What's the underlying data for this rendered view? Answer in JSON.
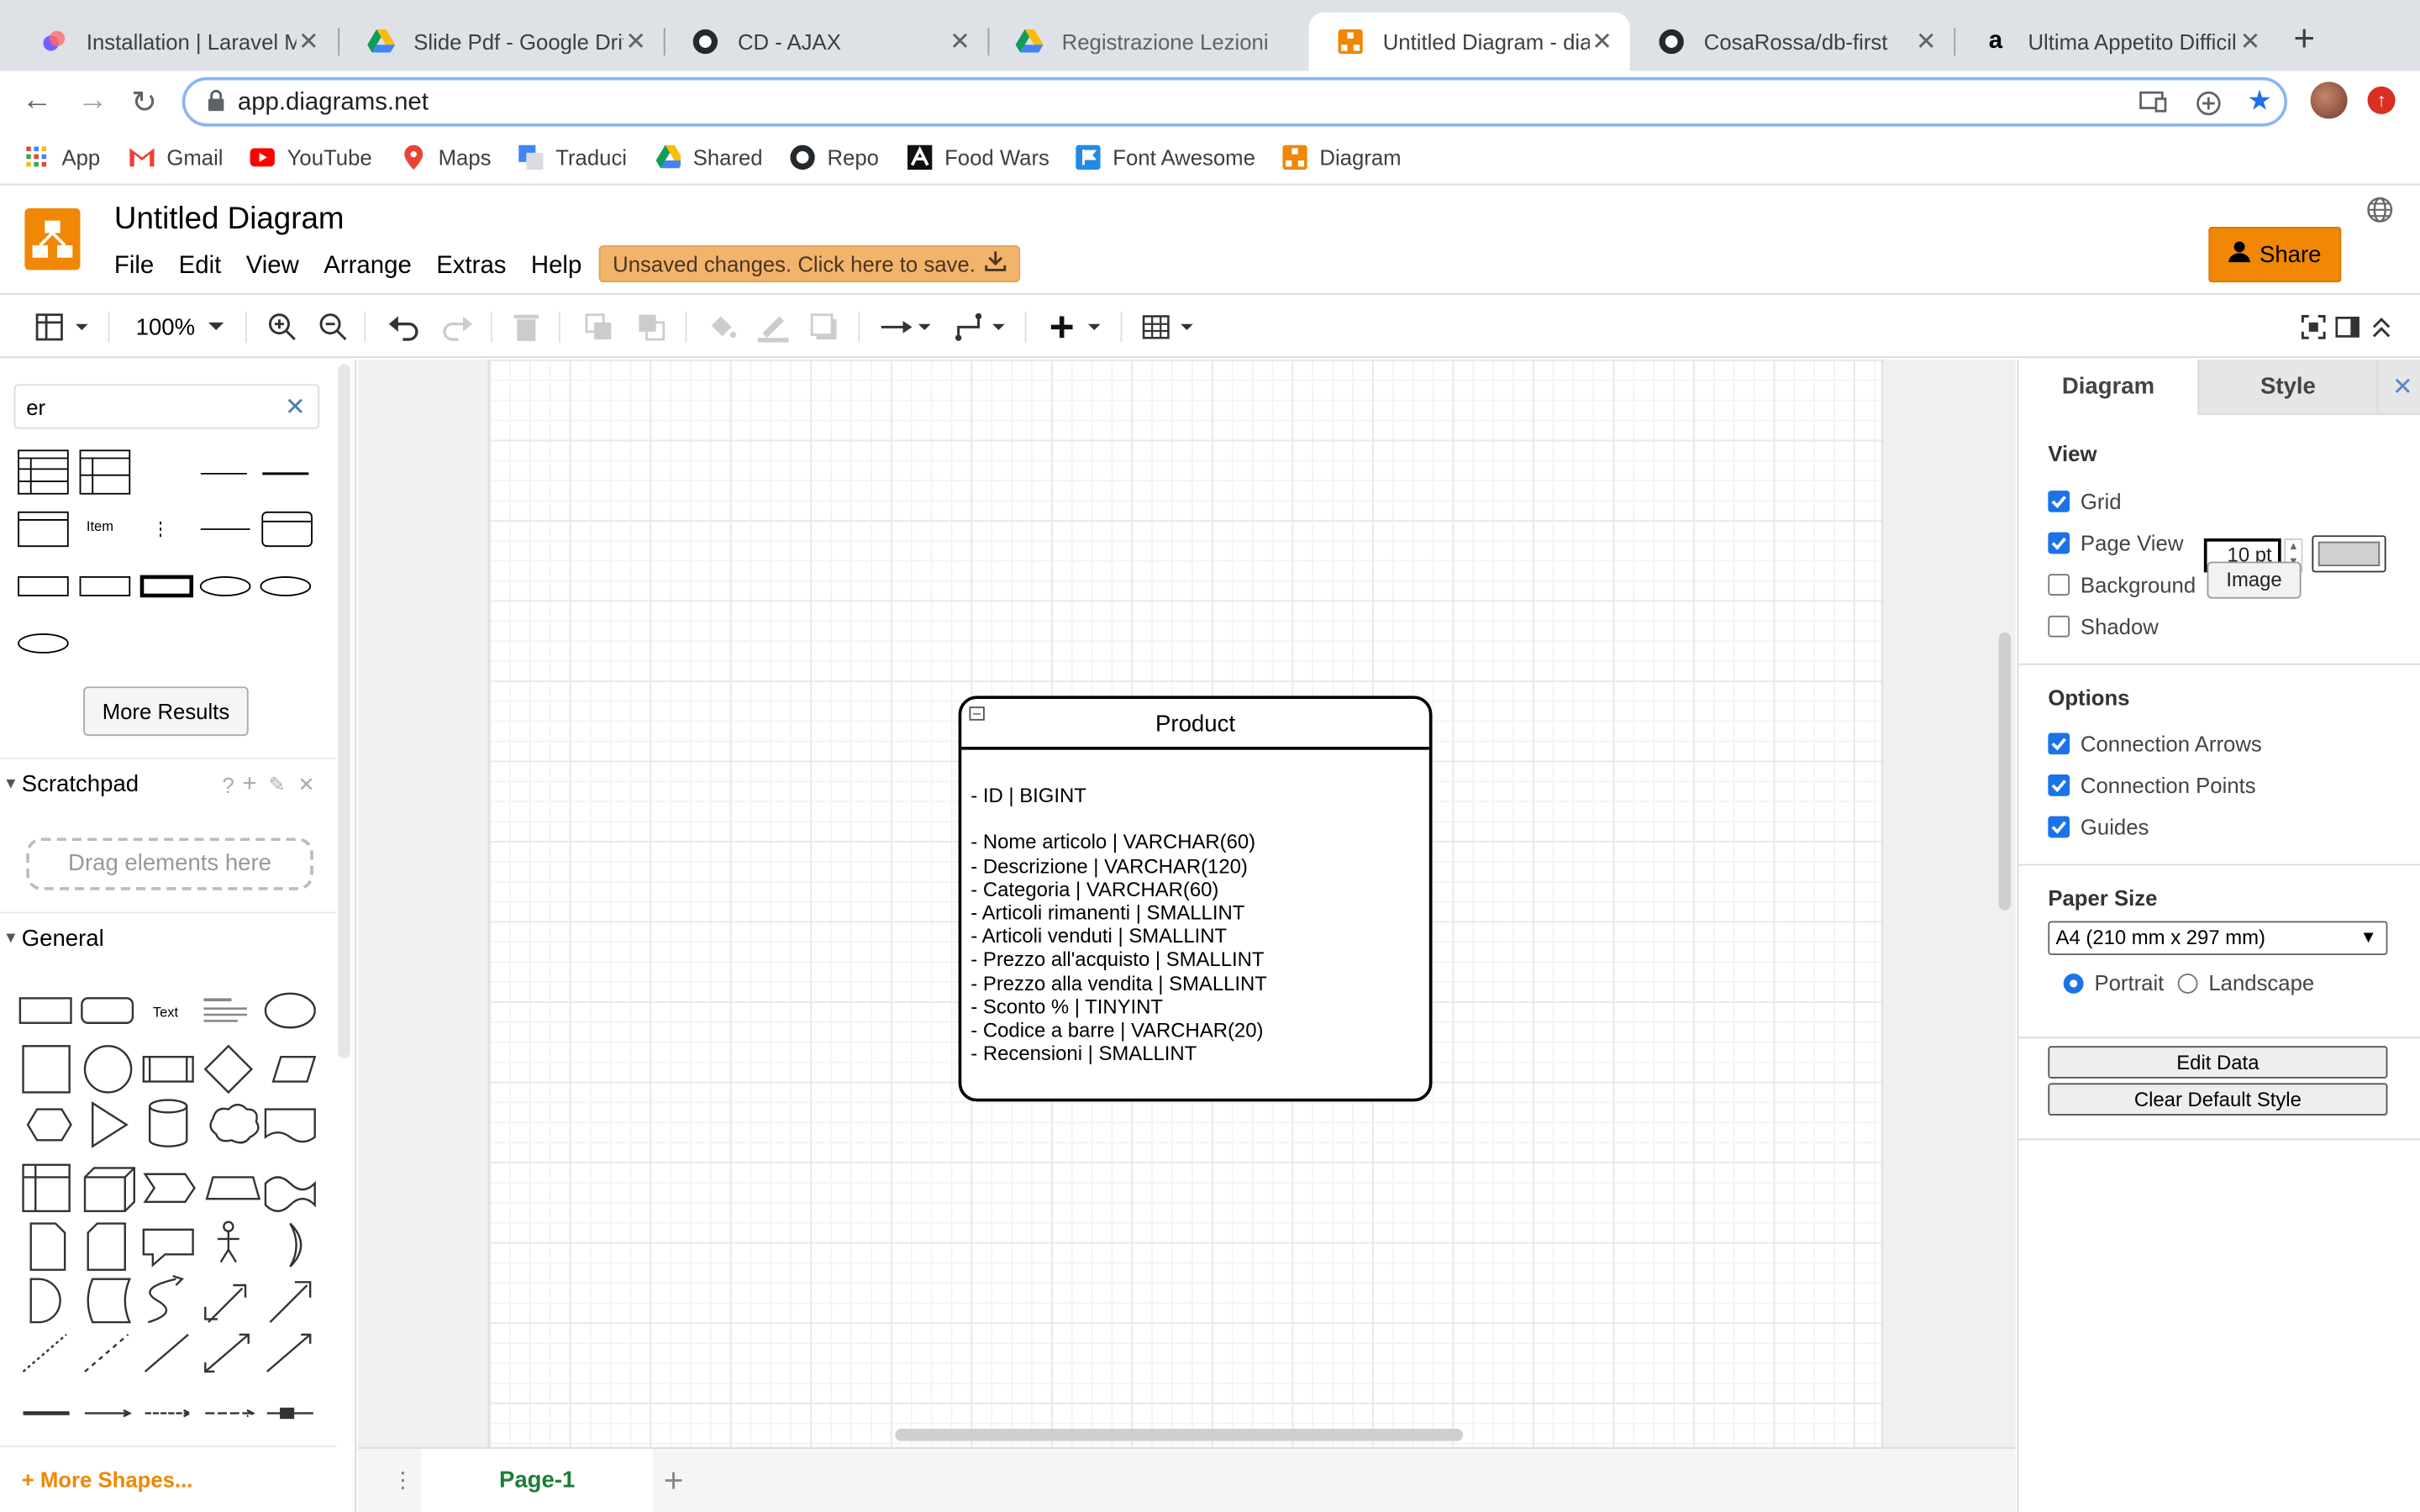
{
  "browser": {
    "tabs": [
      {
        "title": "Installation | Laravel M",
        "icon": "laravel-icon"
      },
      {
        "title": "Slide Pdf - Google Driv",
        "icon": "google-drive-icon"
      },
      {
        "title": "CD - AJAX",
        "icon": "github-icon"
      },
      {
        "title": "Registrazione Lezioni",
        "icon": "google-drive-icon"
      },
      {
        "title": "Untitled Diagram - dia",
        "icon": "drawio-icon"
      },
      {
        "title": "CosaRossa/db-first",
        "icon": "github-icon"
      },
      {
        "title": "Ultima Appetito Difficil",
        "icon": "amazon-icon"
      }
    ],
    "url": "app.diagrams.net",
    "bookmarks": [
      {
        "label": "App",
        "icon": "apps-grid-icon"
      },
      {
        "label": "Gmail",
        "icon": "gmail-icon"
      },
      {
        "label": "YouTube",
        "icon": "youtube-icon"
      },
      {
        "label": "Maps",
        "icon": "maps-icon"
      },
      {
        "label": "Traduci",
        "icon": "translate-icon"
      },
      {
        "label": "Shared",
        "icon": "google-drive-icon"
      },
      {
        "label": "Repo",
        "icon": "github-icon"
      },
      {
        "label": "Food Wars",
        "icon": "anime-icon"
      },
      {
        "label": "Font Awesome",
        "icon": "flag-icon"
      },
      {
        "label": "Diagram",
        "icon": "drawio-icon"
      }
    ]
  },
  "app": {
    "title": "Untitled Diagram",
    "menu": [
      "File",
      "Edit",
      "View",
      "Arrange",
      "Extras",
      "Help"
    ],
    "unsaved": "Unsaved changes. Click here to save.",
    "share": "Share",
    "zoom": "100%",
    "accent": "#f08705"
  },
  "left": {
    "search_value": "er",
    "item_label": "Item",
    "more_results": "More Results",
    "scratchpad": "Scratchpad",
    "drag_hint": "Drag elements here",
    "general": "General",
    "text_shape": "Text",
    "more_shapes": "+ More Shapes..."
  },
  "diagram": {
    "entity_title": "Product",
    "entity_body": "- ID | BIGINT\n\n- Nome articolo | VARCHAR(60)\n- Descrizione | VARCHAR(120)\n- Categoria | VARCHAR(60)\n- Articoli rimanenti | SMALLINT\n- Articoli venduti | SMALLINT\n- Prezzo all'acquisto | SMALLINT\n- Prezzo alla vendita | SMALLINT\n- Sconto % | TINYINT\n- Codice a barre | VARCHAR(20)\n- Recensioni | SMALLINT"
  },
  "pages": {
    "current": "Page-1"
  },
  "right": {
    "tab_diagram": "Diagram",
    "tab_style": "Style",
    "view_title": "View",
    "grid": {
      "label": "Grid",
      "checked": true,
      "size": "10 pt"
    },
    "page_view": {
      "label": "Page View",
      "checked": true
    },
    "background": {
      "label": "Background",
      "checked": false,
      "button": "Image"
    },
    "shadow": {
      "label": "Shadow",
      "checked": false
    },
    "options_title": "Options",
    "connection_arrows": {
      "label": "Connection Arrows",
      "checked": true
    },
    "connection_points": {
      "label": "Connection Points",
      "checked": true
    },
    "guides": {
      "label": "Guides",
      "checked": true
    },
    "paper_title": "Paper Size",
    "paper_value": "A4 (210 mm x 297 mm)",
    "portrait": "Portrait",
    "landscape": "Landscape",
    "edit_data": "Edit Data",
    "clear_style": "Clear Default Style"
  }
}
